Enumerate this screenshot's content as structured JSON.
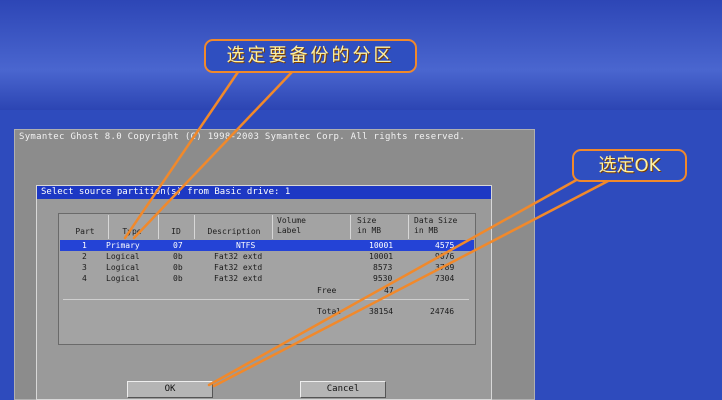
{
  "ghost_window": {
    "title": "Symantec Ghost 8.0   Copyright (C) 1998-2003 Symantec Corp. All rights reserved."
  },
  "dialog": {
    "title": "Select source partition(s) from Basic drive: 1",
    "headers": {
      "part": "Part",
      "type": "Type",
      "id": "ID",
      "description": "Description",
      "volume_label_1": "Volume",
      "volume_label_2": "Label",
      "size_1": "Size",
      "size_2": "in MB",
      "data_size_1": "Data Size",
      "data_size_2": "in MB"
    },
    "rows": [
      {
        "part": "1",
        "type": "Primary",
        "id": "07",
        "description": "NTFS",
        "label": "",
        "size": "10001",
        "data_size": "4575",
        "selected": true
      },
      {
        "part": "2",
        "type": "Logical",
        "id": "0b",
        "description": "Fat32 extd",
        "label": "",
        "size": "10001",
        "data_size": "9076",
        "selected": false
      },
      {
        "part": "3",
        "type": "Logical",
        "id": "0b",
        "description": "Fat32 extd",
        "label": "",
        "size": "8573",
        "data_size": "3789",
        "selected": false
      },
      {
        "part": "4",
        "type": "Logical",
        "id": "0b",
        "description": "Fat32 extd",
        "label": "",
        "size": "9530",
        "data_size": "7304",
        "selected": false
      }
    ],
    "free": {
      "label": "Free",
      "size": "47"
    },
    "total": {
      "label": "Total",
      "size": "38154",
      "data_size": "24746"
    },
    "ok_button": "OK",
    "cancel_button": "Cancel"
  },
  "annotations": {
    "select_partition": "选定要备份的分区",
    "select_ok": "选定OK"
  },
  "colors": {
    "desktop_blue": "#2e4bbd",
    "selection_blue": "#2443d6",
    "arrow_orange": "#f1892b",
    "callout_text": "#fff2a0"
  }
}
